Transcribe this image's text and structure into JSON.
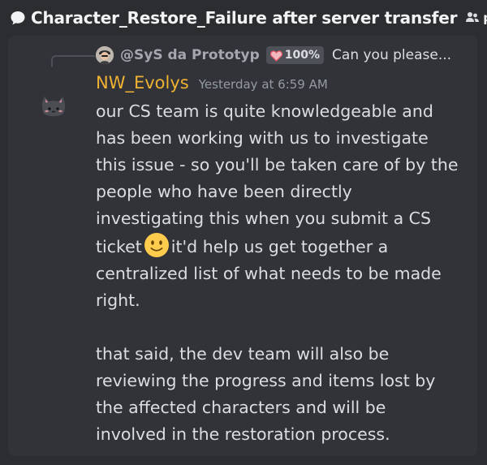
{
  "thread": {
    "title": "Character_Restore_Failure after server transfer",
    "tag_label": "playe",
    "tag_icon": "players-icon"
  },
  "reply": {
    "author": "@SyS da Prototyp",
    "badge": "100%",
    "badge_icon": "heart-icon",
    "preview": "Can you please..."
  },
  "message": {
    "author": "NW_Evolys",
    "author_color": "#f0b232",
    "timestamp": "Yesterday at 6:59 AM",
    "paragraph1_before_emoji": "our CS team is quite knowledgeable and has been working with us to investigate this issue - so you'll be taken care of by the people who have been directly investigating this when you submit a CS ticket",
    "emoji": "slightly-smiling-face",
    "paragraph1_after_emoji": "it'd help us get together a centralized list of what needs to be made right.",
    "paragraph2": "that said, the dev team will also be reviewing the progress and items lost by the affected characters and will be involved in the restoration process."
  }
}
